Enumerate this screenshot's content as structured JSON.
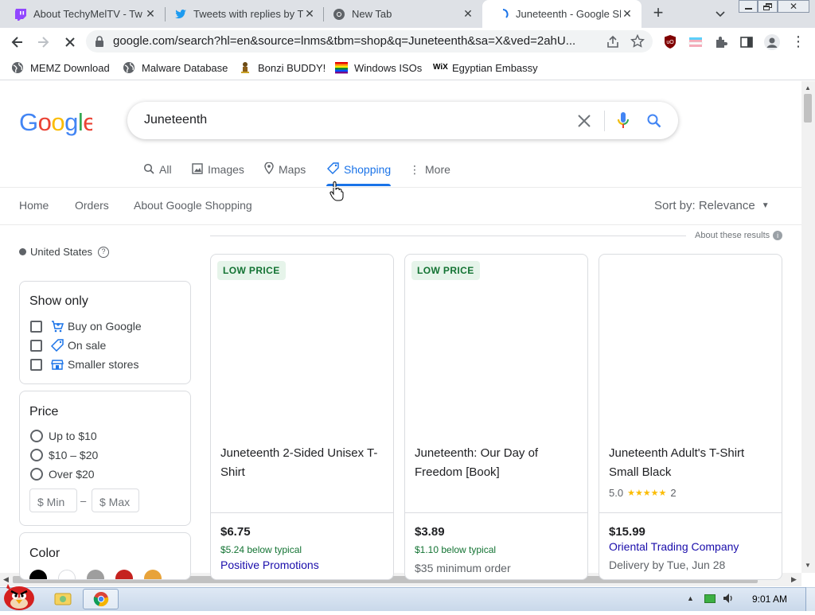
{
  "browser": {
    "tabs": [
      {
        "title": "About TechyMelTV - Tw",
        "icon": "twitch-icon"
      },
      {
        "title": "Tweets with replies by T",
        "icon": "twitter-icon"
      },
      {
        "title": "New Tab",
        "icon": "chrome-icon"
      },
      {
        "title": "Juneteenth - Google Sh",
        "icon": "loading-icon"
      }
    ],
    "url": "google.com/search?hl=en&source=lnms&tbm=shop&q=Juneteenth&sa=X&ved=2ahU...",
    "bookmarks": [
      "MEMZ Download",
      "Malware Database",
      "Bonzi BUDDY!",
      "Windows ISOs",
      "Egyptian Embassy"
    ]
  },
  "search": {
    "query": "Juneteenth"
  },
  "search_tabs": [
    "All",
    "Images",
    "Maps",
    "Shopping",
    "More"
  ],
  "shopping_nav": [
    "Home",
    "Orders",
    "About Google Shopping"
  ],
  "sort_label": "Sort by: Relevance",
  "about_results": "About these results",
  "region": "United States",
  "filters": {
    "show_only": {
      "title": "Show only",
      "options": [
        "Buy on Google",
        "On sale",
        "Smaller stores"
      ]
    },
    "price": {
      "title": "Price",
      "options": [
        "Up to $10",
        "$10 – $20",
        "Over $20"
      ],
      "min_placeholder": "$ Min",
      "max_placeholder": "$ Max",
      "dash": "–"
    },
    "color": {
      "title": "Color"
    }
  },
  "products": [
    {
      "badge": "LOW PRICE",
      "title": "Juneteenth 2-Sided Unisex T-Shirt",
      "price": "$6.75",
      "below": "$5.24 below typical",
      "seller": "Positive Promotions"
    },
    {
      "badge": "LOW PRICE",
      "title": "Juneteenth: Our Day of Freedom [Book]",
      "price": "$3.89",
      "below": "$1.10 below typical",
      "extra": "$35 minimum order"
    },
    {
      "title": "Juneteenth Adult's T-Shirt Small Black",
      "rating": "5.0",
      "stars": "★★★★★",
      "reviews": "2",
      "price": "$15.99",
      "seller": "Oriental Trading Company",
      "extra": "Delivery by Tue, Jun 28"
    }
  ],
  "taskbar": {
    "clock": "9:01 AM"
  }
}
